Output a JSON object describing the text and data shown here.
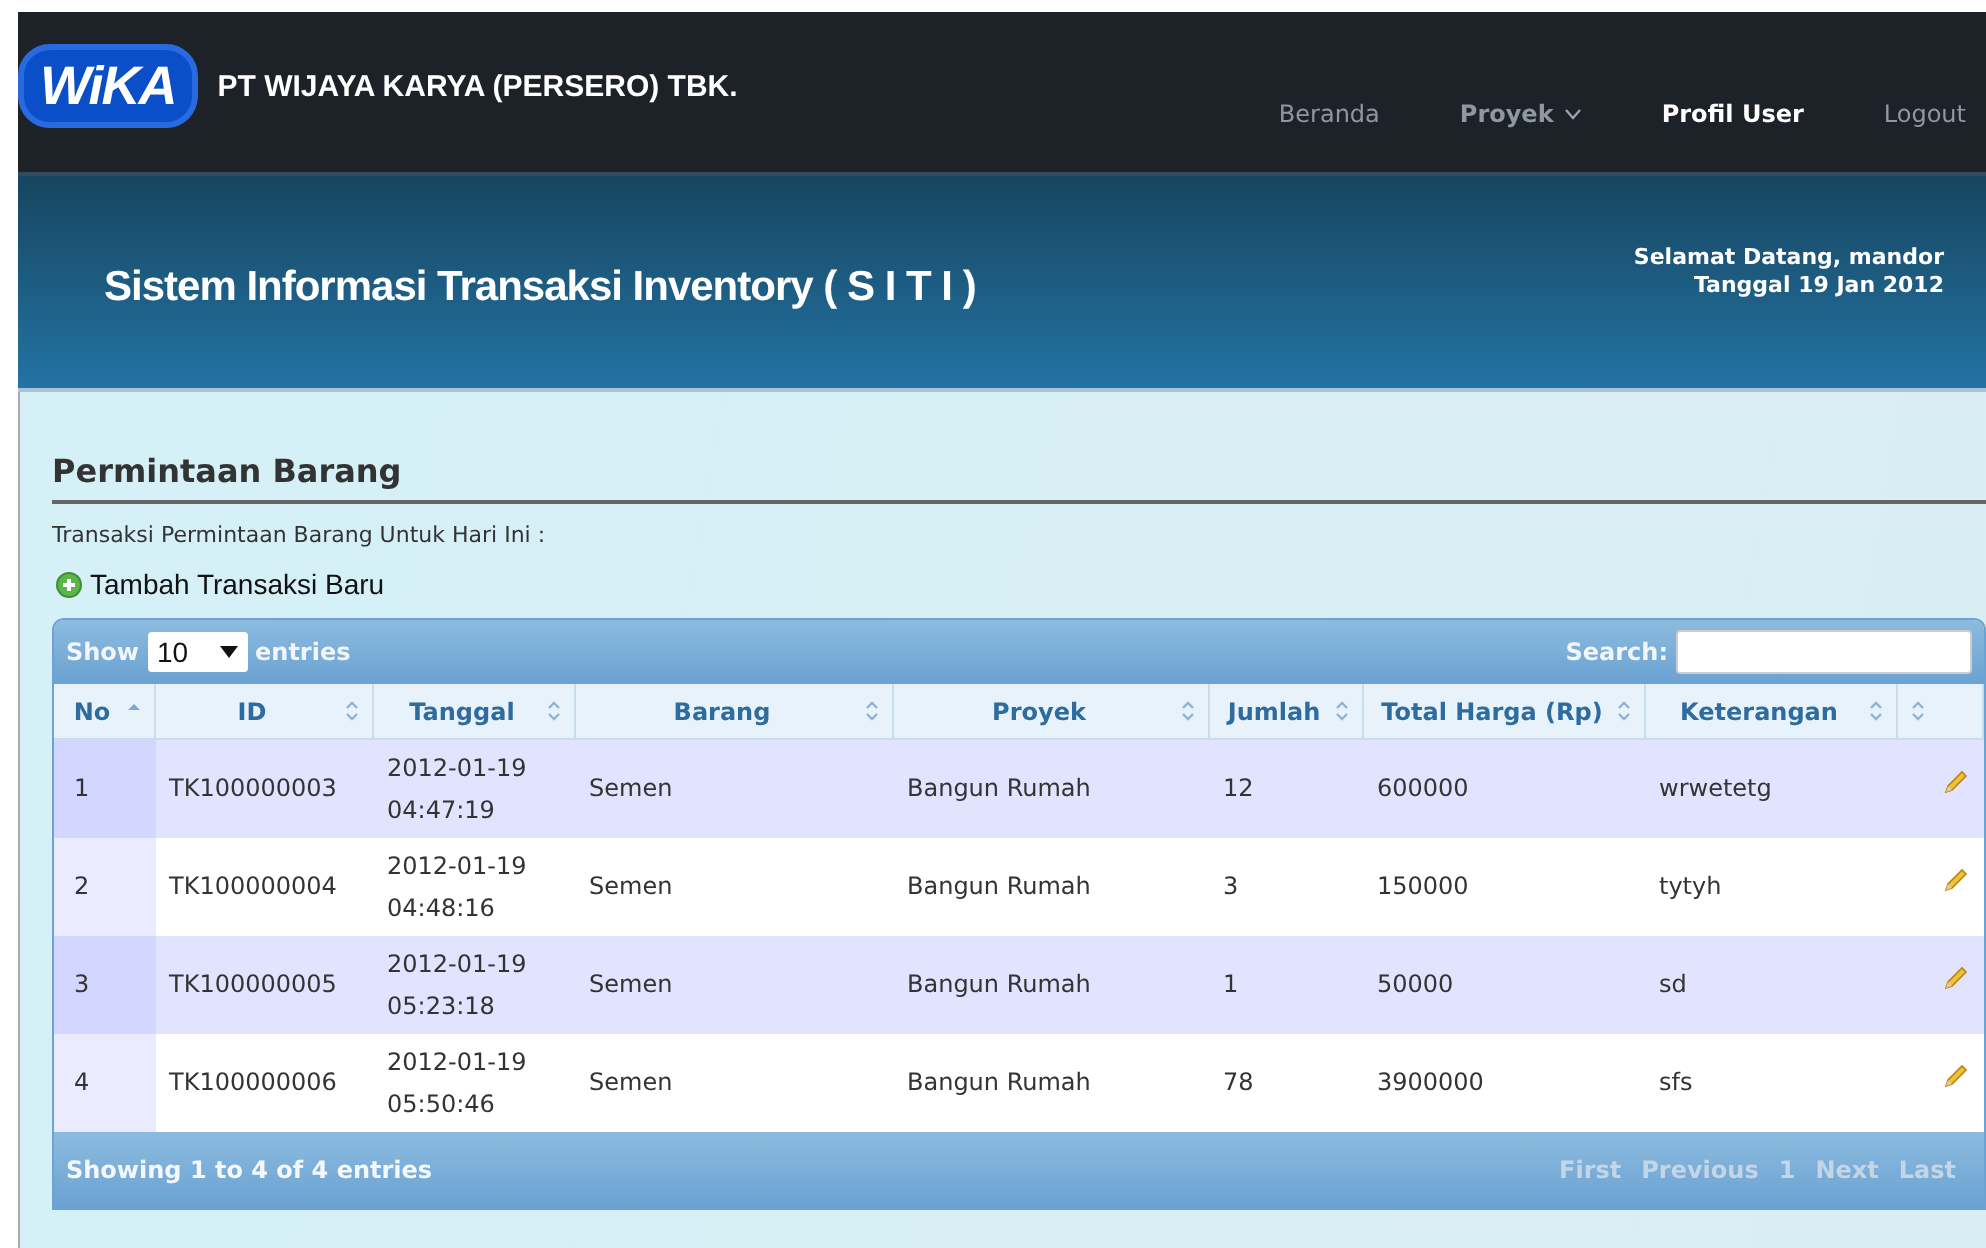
{
  "header": {
    "logo_text": "WiKA",
    "company": "PT WIJAYA KARYA (PERSERO) TBK.",
    "nav": [
      {
        "label": "Beranda",
        "selected": false,
        "has_menu": false
      },
      {
        "label": "Proyek",
        "selected": false,
        "has_menu": true
      },
      {
        "label": "Profil User",
        "selected": true,
        "has_menu": false
      },
      {
        "label": "Logout",
        "selected": false,
        "has_menu": false
      }
    ]
  },
  "banner": {
    "title": "Sistem Informasi Transaksi Inventory ( S I T I )",
    "greeting": "Selamat Datang, mandor",
    "date": "Tanggal 19 Jan 2012"
  },
  "section": {
    "title": "Permintaan Barang",
    "subtitle": "Transaksi Permintaan Barang Untuk Hari Ini :",
    "add_link": "Tambah Transaksi Baru"
  },
  "table": {
    "show_label": "Show",
    "page_size": "10",
    "entries_label": "entries",
    "search_label": "Search:",
    "columns": [
      {
        "label": "No",
        "sorted": true
      },
      {
        "label": "ID",
        "sorted": false
      },
      {
        "label": "Tanggal",
        "sorted": false
      },
      {
        "label": "Barang",
        "sorted": false
      },
      {
        "label": "Proyek",
        "sorted": false
      },
      {
        "label": "Jumlah",
        "sorted": false
      },
      {
        "label": "Total Harga (Rp)",
        "sorted": false
      },
      {
        "label": "Keterangan",
        "sorted": false
      },
      {
        "sorted": false
      }
    ],
    "rows": [
      {
        "cells": [
          "1",
          "TK100000003",
          "2012-01-19 04:47:19",
          "Semen",
          "Bangun Rumah",
          "12",
          "600000",
          "wrwetetg"
        ]
      },
      {
        "cells": [
          "2",
          "TK100000004",
          "2012-01-19 04:48:16",
          "Semen",
          "Bangun Rumah",
          "3",
          "150000",
          "tytyh"
        ]
      },
      {
        "cells": [
          "3",
          "TK100000005",
          "2012-01-19 05:23:18",
          "Semen",
          "Bangun Rumah",
          "1",
          "50000",
          "sd"
        ]
      },
      {
        "cells": [
          "4",
          "TK100000006",
          "2012-01-19 05:50:46",
          "Semen",
          "Bangun Rumah",
          "78",
          "3900000",
          "sfs"
        ]
      }
    ],
    "info": "Showing 1 to 4 of 4 entries",
    "pages": [
      {
        "label": "First",
        "disabled": true
      },
      {
        "label": "Previous",
        "disabled": true
      },
      {
        "label": "1",
        "disabled": true
      },
      {
        "label": "Next",
        "disabled": true
      },
      {
        "label": "Last",
        "disabled": true
      }
    ]
  }
}
